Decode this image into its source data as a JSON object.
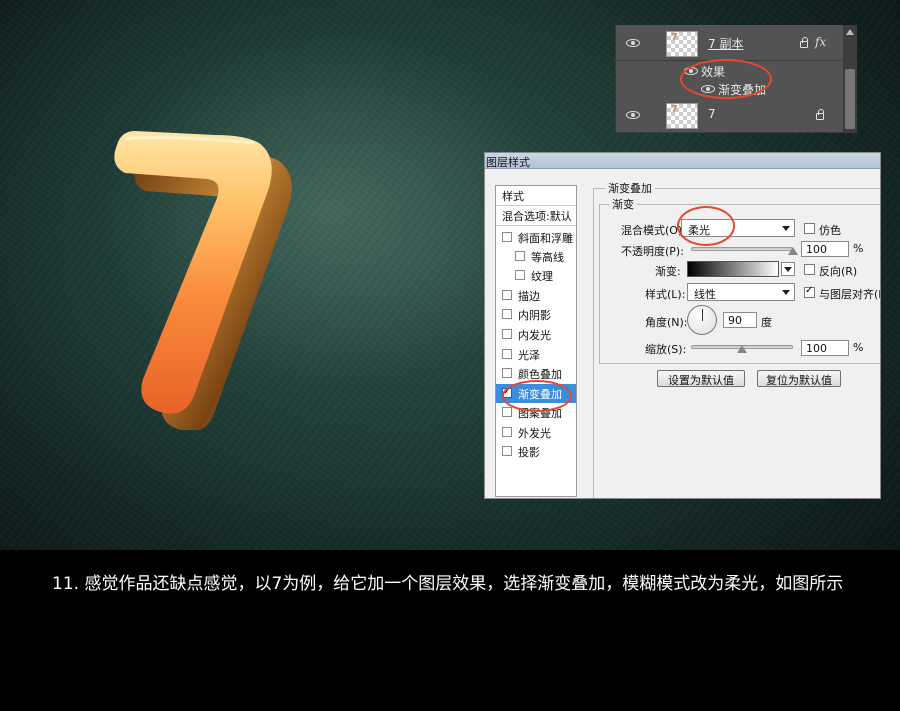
{
  "colors": {
    "annotation_circle": "#e8472a",
    "selected_item": "#3b8de0",
    "background": "#1b3430"
  },
  "layers_panel": {
    "top_layer": {
      "name": "7 副本",
      "thumb_text": "7",
      "icons": [
        "eye-icon",
        "lock-icon",
        "fx-icon"
      ],
      "fx": "fx"
    },
    "effects_label": "效果",
    "gradient_effect_label": "渐变叠加",
    "bottom_layer": {
      "name": "7",
      "thumb_text": "7"
    }
  },
  "dialog": {
    "title": "图层样式",
    "styles_header": "样式",
    "blend_options": "混合选项:默认",
    "styles": [
      {
        "label": "斜面和浮雕",
        "checked": false,
        "sub": false
      },
      {
        "label": "等高线",
        "checked": false,
        "sub": true
      },
      {
        "label": "纹理",
        "checked": false,
        "sub": true
      },
      {
        "label": "描边",
        "checked": false,
        "sub": false
      },
      {
        "label": "内阴影",
        "checked": false,
        "sub": false
      },
      {
        "label": "内发光",
        "checked": false,
        "sub": false
      },
      {
        "label": "光泽",
        "checked": false,
        "sub": false
      },
      {
        "label": "颜色叠加",
        "checked": false,
        "sub": false
      },
      {
        "label": "渐变叠加",
        "checked": true,
        "sub": false,
        "selected": true
      },
      {
        "label": "图案叠加",
        "checked": false,
        "sub": false
      },
      {
        "label": "外发光",
        "checked": false,
        "sub": false
      },
      {
        "label": "投影",
        "checked": false,
        "sub": false
      }
    ],
    "section_title": "渐变叠加",
    "group_title": "渐变",
    "blend_mode_label": "混合模式(O):",
    "blend_mode_value": "柔光",
    "dither_label": "仿色",
    "dither_checked": false,
    "opacity_label": "不透明度(P):",
    "opacity_value": "100",
    "opacity_unit": "%",
    "opacity_level": 1.0,
    "gradient_label": "渐变:",
    "reverse_label": "反向(R)",
    "reverse_checked": false,
    "style_label": "样式(L):",
    "style_value": "线性",
    "align_label": "与图层对齐(I)",
    "align_checked": true,
    "angle_label": "角度(N):",
    "angle_value": "90",
    "angle_unit": "度",
    "scale_label": "缩放(S):",
    "scale_value": "100",
    "scale_unit": "%",
    "scale_level": 0.5,
    "default_button": "设置为默认值",
    "reset_button": "复位为默认值"
  },
  "caption": "11. 感觉作品还缺点感觉，以7为例，给它加一个图层效果，选择渐变叠加，模糊模式改为柔光，如图所示"
}
